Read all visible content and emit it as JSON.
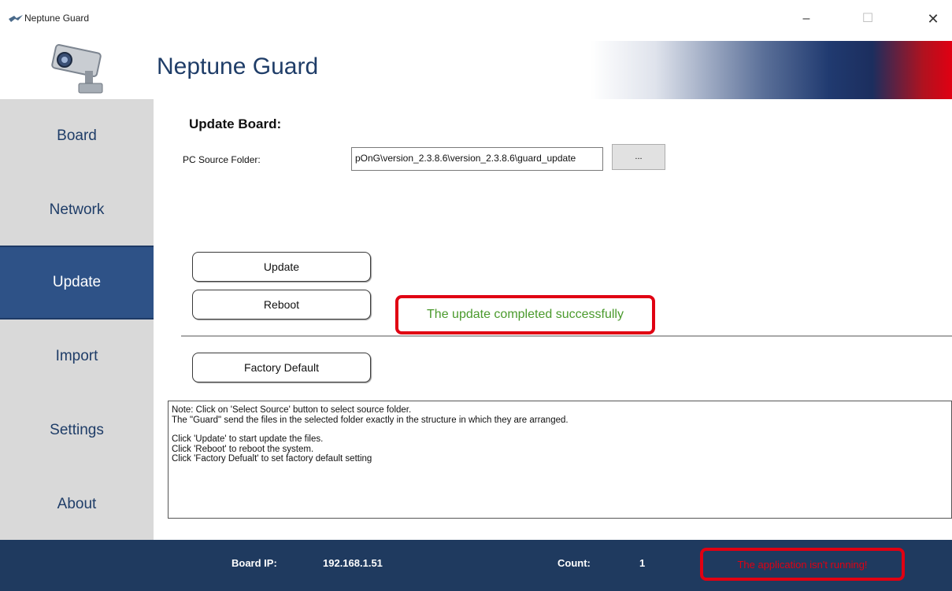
{
  "window": {
    "title": "Neptune Guard",
    "minimize": "–",
    "maximize": "☐",
    "close": "✕"
  },
  "header": {
    "app_name": "Neptune Guard",
    "logo_icon": "security-camera-icon"
  },
  "sidebar": {
    "items": [
      {
        "label": "Board"
      },
      {
        "label": "Network"
      },
      {
        "label": "Update",
        "active": true
      },
      {
        "label": "Import"
      },
      {
        "label": "Settings"
      },
      {
        "label": "About"
      }
    ]
  },
  "main": {
    "section_title": "Update Board:",
    "source_label": "PC Source Folder:",
    "source_value": "pOnG\\version_2.3.8.6\\version_2.3.8.6\\guard_update",
    "browse_label": "...",
    "update_label": "Update",
    "reboot_label": "Reboot",
    "factory_label": "Factory Default",
    "success_message": "The update completed successfully",
    "notes": [
      "Note: Click on 'Select Source' button to select source folder.",
      "The \"Guard\" send the files in the selected folder exactly in the structure in which they are arranged.",
      "",
      "Click 'Update' to start update the files.",
      "Click 'Reboot' to reboot the system.",
      "Click 'Factory Defualt' to set factory default setting"
    ]
  },
  "status": {
    "board_ip_label": "Board IP:",
    "board_ip_value": "192.168.1.51",
    "count_label": "Count:",
    "count_value": "1",
    "app_status": "The application isn't running!"
  },
  "colors": {
    "brand_navy": "#1f3a5f",
    "active_nav": "#2e5287",
    "success_green": "#4a9a2c",
    "alert_red": "#e00012"
  }
}
